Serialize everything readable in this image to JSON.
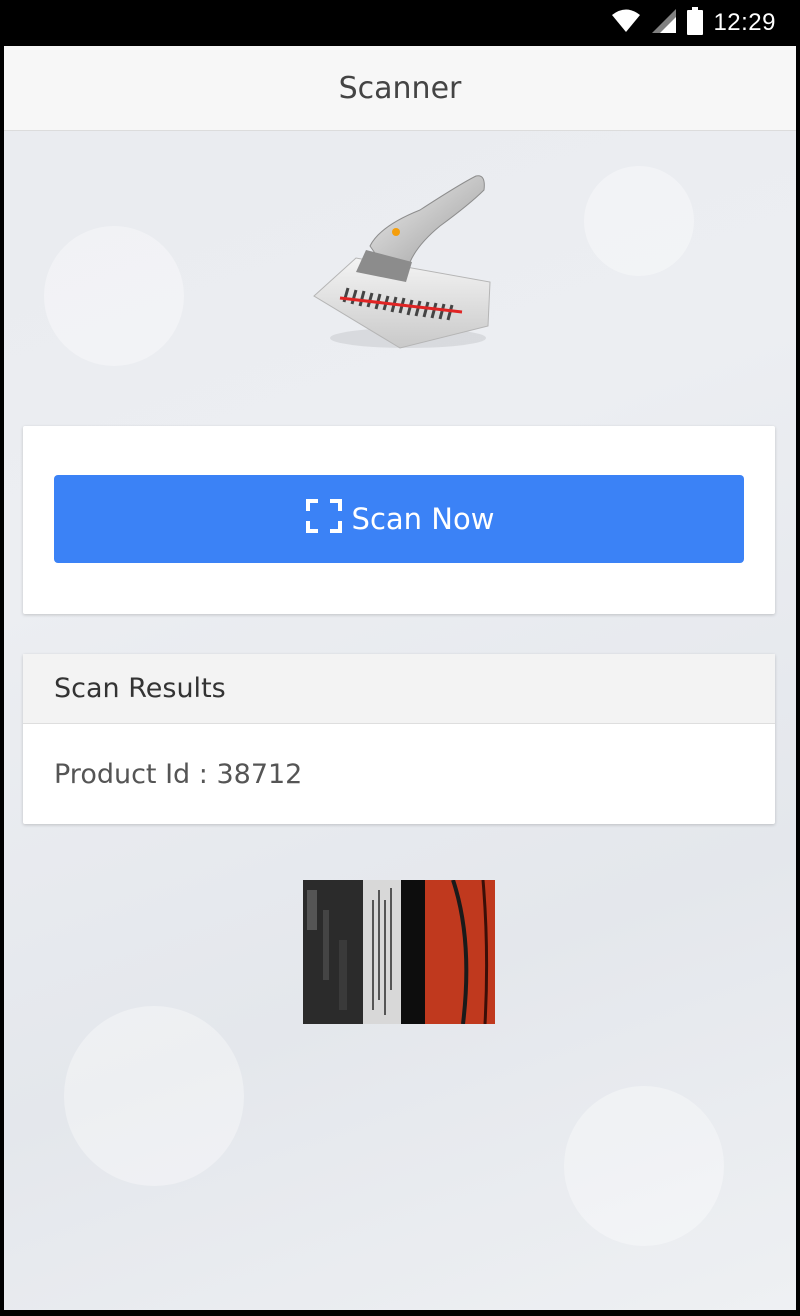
{
  "status_bar": {
    "time": "12:29",
    "icons": [
      "wifi-icon",
      "signal-icon",
      "battery-icon"
    ]
  },
  "header": {
    "title": "Scanner"
  },
  "scan_card": {
    "button_label": "Scan Now",
    "button_icon": "scan-frame-icon",
    "button_color": "#3b82f6"
  },
  "results": {
    "heading": "Scan Results",
    "product_line": "Product Id : 38712"
  },
  "illustration": {
    "icon": "barcode-scanner-icon"
  },
  "thumbnail": {
    "icon": "scanned-image-thumbnail"
  }
}
